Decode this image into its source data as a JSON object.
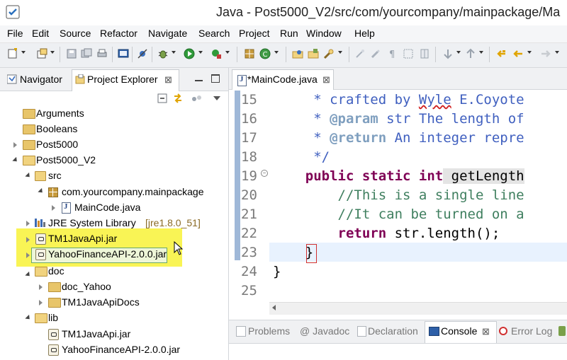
{
  "window": {
    "title": "Java - Post5000_V2/src/com/yourcompany/mainpackage/Ma"
  },
  "menu": [
    "File",
    "Edit",
    "Source",
    "Refactor",
    "Navigate",
    "Search",
    "Project",
    "Run",
    "Window",
    "Help"
  ],
  "left_panel": {
    "tabs": [
      {
        "label": "Navigator",
        "active": false
      },
      {
        "label": "Project Explorer",
        "active": true
      }
    ],
    "close_glyph": "⊠",
    "tree": [
      {
        "label": "Arguments",
        "icon": "folder-icon",
        "twisty": "none"
      },
      {
        "label": "Booleans",
        "icon": "folder-icon",
        "twisty": "none"
      },
      {
        "label": "Post5000",
        "icon": "folder-icon",
        "twisty": "collapsed"
      },
      {
        "label": "Post5000_V2",
        "icon": "open-folder-icon",
        "twisty": "expanded"
      },
      {
        "label": "src",
        "icon": "source-folder-icon",
        "twisty": "expanded"
      },
      {
        "label": "com.yourcompany.mainpackage",
        "icon": "package-icon",
        "twisty": "expanded"
      },
      {
        "label": "MainCode.java",
        "icon": "java-file-icon",
        "twisty": "collapsed"
      },
      {
        "label": "JRE System Library",
        "suffix": "[jre1.8.0_51]",
        "icon": "library-icon",
        "twisty": "collapsed"
      },
      {
        "label": "TM1JavaApi.jar",
        "icon": "jar-icon",
        "twisty": "collapsed"
      },
      {
        "label": "YahooFinanceAPI-2.0.0.jar",
        "icon": "jar-icon",
        "twisty": "collapsed"
      },
      {
        "label": "doc",
        "icon": "open-folder-icon",
        "twisty": "expanded"
      },
      {
        "label": "doc_Yahoo",
        "icon": "folder-icon",
        "twisty": "collapsed"
      },
      {
        "label": "TM1JavaApiDocs",
        "icon": "folder-icon",
        "twisty": "collapsed"
      },
      {
        "label": "lib",
        "icon": "open-folder-icon",
        "twisty": "expanded"
      },
      {
        "label": "TM1JavaApi.jar",
        "icon": "jar-icon",
        "twisty": "none"
      },
      {
        "label": "YahooFinanceAPI-2.0.0.jar",
        "icon": "jar-icon",
        "twisty": "none"
      }
    ]
  },
  "editor": {
    "tab_label": "*MainCode.java",
    "lines": [
      {
        "n": "15",
        "parts": [
          {
            "t": "     * crafted by ",
            "c": "doc"
          },
          {
            "t": "Wyle",
            "c": "doc"
          },
          {
            "t": " E.Coyote",
            "c": "doc"
          }
        ]
      },
      {
        "n": "16",
        "parts": [
          {
            "t": "     * ",
            "c": "doc"
          },
          {
            "t": "@param",
            "c": "tag"
          },
          {
            "t": " str The length of",
            "c": "doc"
          }
        ]
      },
      {
        "n": "17",
        "parts": [
          {
            "t": "     * ",
            "c": "doc"
          },
          {
            "t": "@return",
            "c": "tag"
          },
          {
            "t": " An integer repre",
            "c": "doc"
          }
        ]
      },
      {
        "n": "18",
        "parts": [
          {
            "t": "     */",
            "c": "doc"
          }
        ]
      },
      {
        "n": "19",
        "parts": [
          {
            "t": "    ",
            "c": "plain"
          },
          {
            "t": "public static int",
            "c": "kw"
          },
          {
            "t": " getLength",
            "c": "plain"
          }
        ]
      },
      {
        "n": "20",
        "parts": [
          {
            "t": "        //This is a single line",
            "c": "com"
          }
        ]
      },
      {
        "n": "21",
        "parts": [
          {
            "t": "        //It can be turned on a",
            "c": "com"
          }
        ]
      },
      {
        "n": "22",
        "parts": [
          {
            "t": "        ",
            "c": "plain"
          },
          {
            "t": "return",
            "c": "kw"
          },
          {
            "t": " str.length();",
            "c": "plain"
          }
        ]
      },
      {
        "n": "23",
        "parts": [
          {
            "t": "    }",
            "c": "plain"
          }
        ]
      },
      {
        "n": "24",
        "parts": [
          {
            "t": "}",
            "c": "plain"
          }
        ]
      },
      {
        "n": "25",
        "parts": []
      }
    ]
  },
  "bottom_panel": {
    "tabs": [
      {
        "label": "Problems",
        "active": false
      },
      {
        "label": "@ Javadoc",
        "active": false
      },
      {
        "label": "Declaration",
        "active": false
      },
      {
        "label": "Console",
        "active": true
      },
      {
        "label": "Error Log",
        "active": false
      }
    ]
  }
}
